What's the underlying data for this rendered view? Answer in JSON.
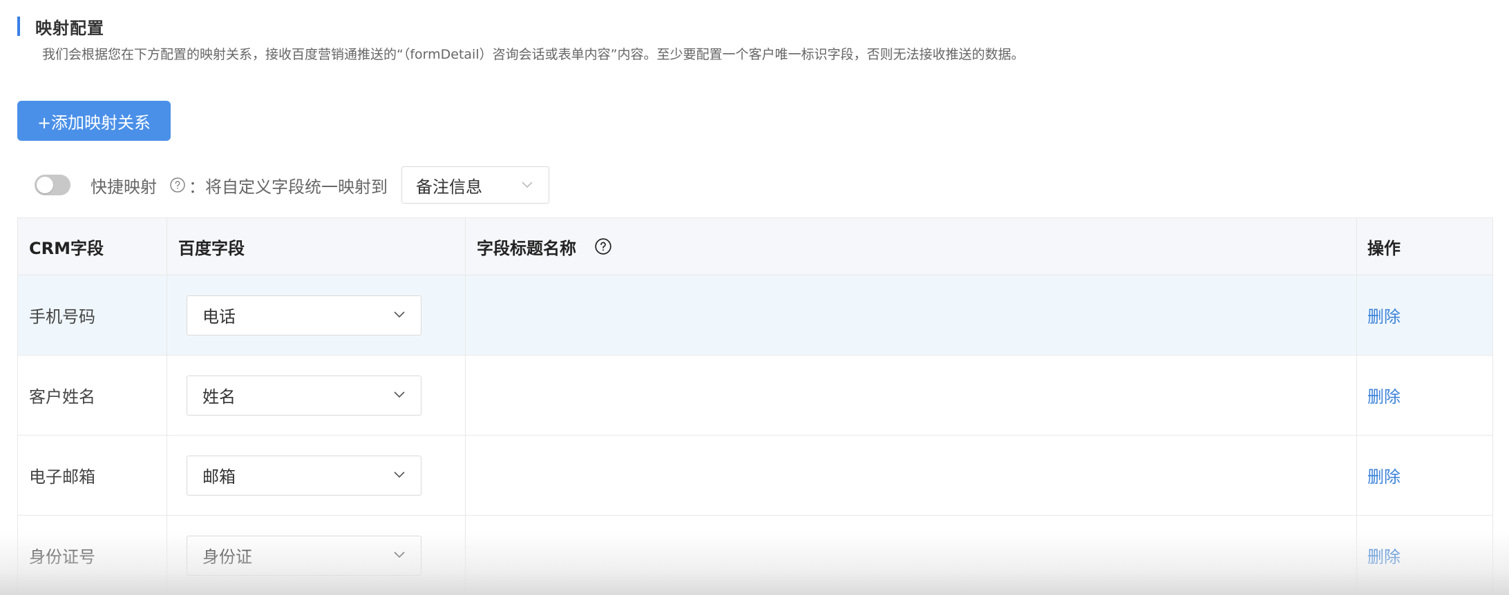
{
  "section": {
    "title": "映射配置",
    "description": "我们会根据您在下方配置的映射关系，接收百度营销通推送的“（formDetail）咨询会话或表单内容”内容。至少要配置一个客户唯一标识字段，否则无法接收推送的数据。"
  },
  "toolbar": {
    "add_button_label": "+添加映射关系"
  },
  "quick_mapping": {
    "enabled": false,
    "label": "快捷映射",
    "help_icon": "question-circle-icon",
    "text": "：将自定义字段统一映射到",
    "selected": "备注信息"
  },
  "table": {
    "headers": {
      "crm_field": "CRM字段",
      "baidu_field": "百度字段",
      "field_title": "字段标题名称",
      "operation": "操作"
    },
    "rows": [
      {
        "crm_field": "手机号码",
        "baidu_field": "电话",
        "field_title": "",
        "action": "删除"
      },
      {
        "crm_field": "客户姓名",
        "baidu_field": "姓名",
        "field_title": "",
        "action": "删除"
      },
      {
        "crm_field": "电子邮箱",
        "baidu_field": "邮箱",
        "field_title": "",
        "action": "删除"
      },
      {
        "crm_field": "身份证号",
        "baidu_field": "身份证",
        "field_title": "",
        "action": "删除"
      }
    ]
  },
  "colors": {
    "accent": "#3b7fe6",
    "button": "#4a90e9",
    "link": "#3b82d9",
    "header_bg": "#f5f7fa",
    "highlight_row_bg": "#f0f7fc"
  }
}
